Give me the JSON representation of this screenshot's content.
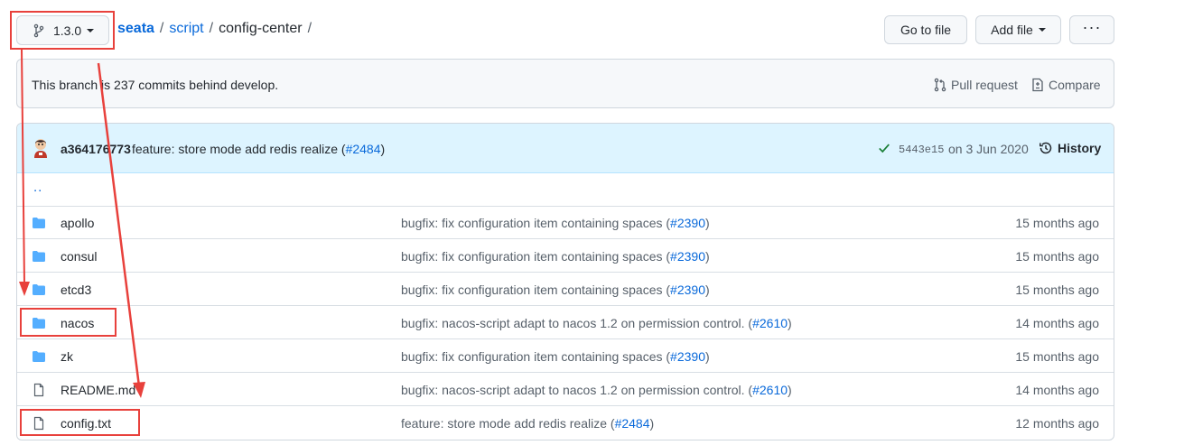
{
  "branch": {
    "label": "1.3.0"
  },
  "breadcrumb": {
    "repo": "seata",
    "dir1": "script",
    "dir2": "config-center",
    "sep": "/"
  },
  "actions": {
    "goto": "Go to file",
    "addfile": "Add file",
    "more": "···"
  },
  "behind": {
    "message": "This branch is 237 commits behind develop.",
    "pull_request": "Pull request",
    "compare": "Compare"
  },
  "commit": {
    "author": "a364176773",
    "message": "feature: store mode add redis realize (",
    "pr": "#2484",
    "close": ")",
    "sha": "5443e15",
    "date": "on 3 Jun 2020",
    "history": "History"
  },
  "parent_dir": "..",
  "files": [
    {
      "name": "apollo",
      "type": "dir",
      "msg": "bugfix: fix configuration item containing spaces (",
      "pr": "#2390",
      "close": ")",
      "age": "15 months ago"
    },
    {
      "name": "consul",
      "type": "dir",
      "msg": "bugfix: fix configuration item containing spaces (",
      "pr": "#2390",
      "close": ")",
      "age": "15 months ago"
    },
    {
      "name": "etcd3",
      "type": "dir",
      "msg": "bugfix: fix configuration item containing spaces (",
      "pr": "#2390",
      "close": ")",
      "age": "15 months ago"
    },
    {
      "name": "nacos",
      "type": "dir",
      "msg": "bugfix: nacos-script adapt to nacos 1.2 on permission control. (",
      "pr": "#2610",
      "close": ")",
      "age": "14 months ago"
    },
    {
      "name": "zk",
      "type": "dir",
      "msg": "bugfix: fix configuration item containing spaces (",
      "pr": "#2390",
      "close": ")",
      "age": "15 months ago"
    },
    {
      "name": "README.md",
      "type": "file",
      "msg": "bugfix: nacos-script adapt to nacos 1.2 on permission control. (",
      "pr": "#2610",
      "close": ")",
      "age": "14 months ago"
    },
    {
      "name": "config.txt",
      "type": "file",
      "msg": "feature: store mode add redis realize (",
      "pr": "#2484",
      "close": ")",
      "age": "12 months ago"
    }
  ],
  "colors": {
    "accent": "#0969da",
    "folder": "#54aeff",
    "annotation": "#e8413c",
    "success": "#1a7f37"
  }
}
